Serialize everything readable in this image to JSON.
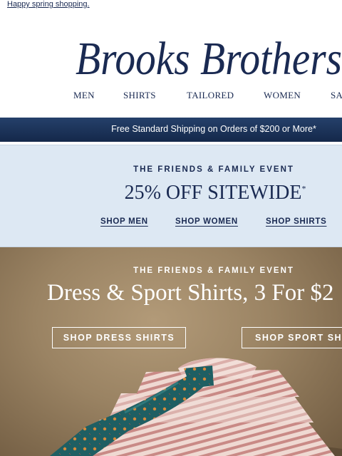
{
  "preheader": {
    "link_text": "Happy spring shopping."
  },
  "brand": {
    "name": "Brooks Brothers"
  },
  "nav": {
    "items": [
      "MEN",
      "SHIRTS",
      "TAILORED",
      "WOMEN",
      "SA"
    ]
  },
  "shipping": {
    "text": "Free Standard Shipping on Orders of $200 or More*"
  },
  "promo": {
    "kicker": "THE FRIENDS & FAMILY EVENT",
    "headline": "25% OFF SITEWIDE",
    "asterisk": "*",
    "links": [
      "SHOP MEN",
      "SHOP WOMEN",
      "SHOP SHIRTS"
    ]
  },
  "hero": {
    "kicker": "THE FRIENDS & FAMILY EVENT",
    "title": "Dress & Sport Shirts, 3 For $2",
    "buttons": [
      "SHOP DRESS SHIRTS",
      "SHOP SPORT SHI"
    ]
  },
  "colors": {
    "navy": "#1a2a52",
    "light_blue": "#dde8f3",
    "tan": "#9a8363",
    "tie_teal": "#1f5f63",
    "shirt_stripe": "#c98a86"
  }
}
